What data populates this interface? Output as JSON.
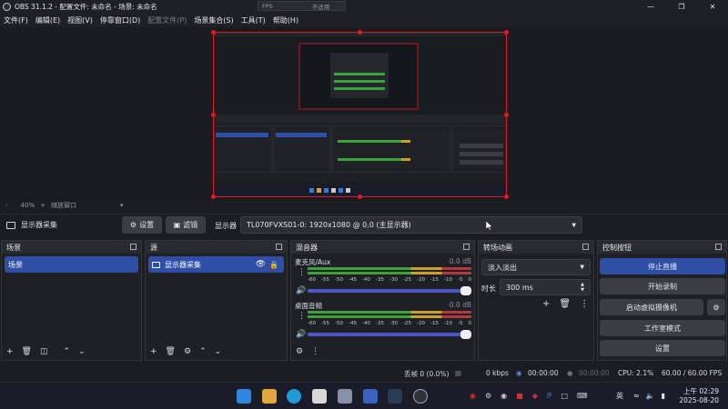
{
  "window": {
    "title": "OBS 31.1.2 - 配置文件: 未命名 - 场景: 未命名",
    "fps_label": "FPS",
    "fps_value": "不适用"
  },
  "menu": [
    "文件(F)",
    "编辑(E)",
    "视图(V)",
    "停靠窗口(D)",
    "配置文件(P)",
    "场景集合(S)",
    "工具(T)",
    "帮助(H)"
  ],
  "menu_disabled_index": 4,
  "zoom": {
    "minus": "-",
    "value": "40%",
    "plus": "+",
    "label": "缩放窗口"
  },
  "source_toolbar": {
    "source_name": "显示器采集",
    "settings_label": "设置",
    "filters_label": "滤镜",
    "display_label": "显示器",
    "display_value": "TL070FVXS01-0: 1920x1080 @ 0,0 (主显示器)"
  },
  "scenes": {
    "title": "场景",
    "items": [
      "场景"
    ]
  },
  "sources": {
    "title": "源",
    "items": [
      "显示器采集"
    ]
  },
  "mixer": {
    "title": "混音器",
    "tracks": [
      {
        "name": "麦克风/Aux",
        "db": "0.0 dB"
      },
      {
        "name": "桌面音频",
        "db": "0.0 dB"
      }
    ],
    "scale": [
      "-60",
      "-55",
      "-50",
      "-45",
      "-40",
      "-35",
      "-30",
      "-25",
      "-20",
      "-15",
      "-10",
      "-5",
      "0"
    ]
  },
  "transitions": {
    "title": "转场动画",
    "type": "淡入淡出",
    "duration_label": "时长",
    "duration_value": "300 ms"
  },
  "controls": {
    "title": "控制按钮",
    "buttons": [
      "停止直播",
      "开始录制",
      "启动虚拟摄像机",
      "工作室模式",
      "设置"
    ]
  },
  "status": {
    "dropped": "丢帧 0 (0.0%)",
    "kbps": "0 kbps",
    "stream_time": "00:00:00",
    "rec_time": "00:00:00",
    "cpu": "CPU: 2.1%",
    "fps": "60.00 / 60.00 FPS"
  },
  "taskbar": {
    "ime": "英",
    "time": "上午 02:29",
    "date": "2025-08-20"
  },
  "colors": {
    "accent": "#2f4ea5",
    "selection_border": "#e01b24",
    "meter_green": "#3aa33a",
    "meter_yellow": "#c9a227",
    "meter_red": "#b23a3a"
  }
}
